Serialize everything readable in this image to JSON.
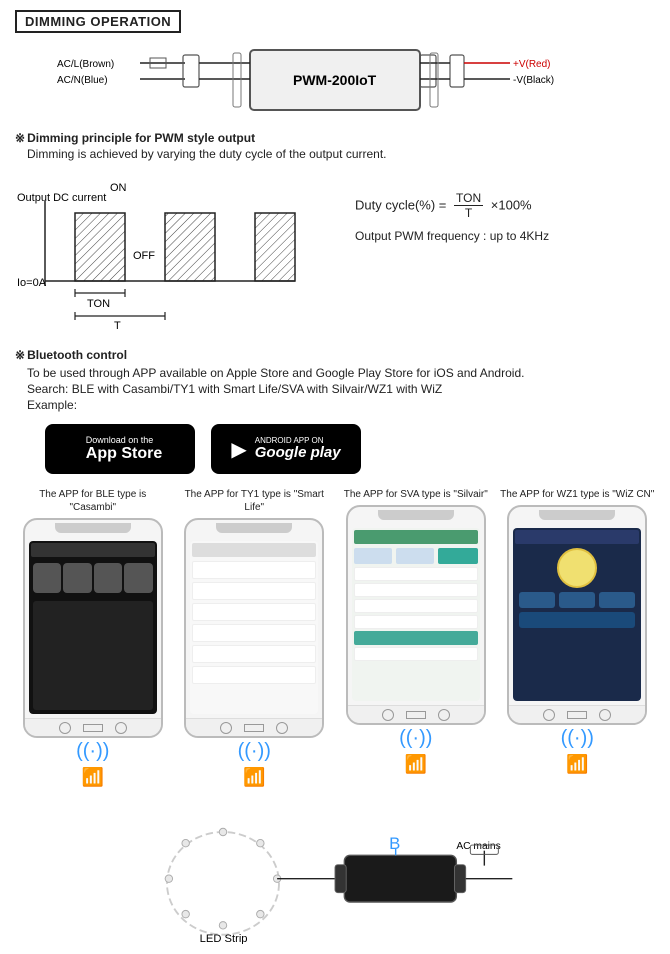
{
  "header": {
    "title": "DIMMING OPERATION"
  },
  "wiring": {
    "device_label": "PWM-200IoT",
    "input_ac_l": "AC/L(Brown)",
    "input_ac_n": "AC/N(Blue)",
    "output_pos": "+V(Red)",
    "output_neg": "-V(Black)"
  },
  "dimming_principle": {
    "title": "Dimming principle for PWM style output",
    "description": "Dimming is achieved by varying the duty cycle of the output current.",
    "y_label": "Output DC current",
    "on_label": "ON",
    "off_label": "OFF",
    "io_label": "Io=0A",
    "ton_label": "TON",
    "t_label": "T",
    "formula_prefix": "Duty cycle(%) =",
    "formula_num": "TON",
    "formula_den": "T",
    "formula_suffix": "×100%",
    "freq_text": "Output PWM frequency : up to 4KHz"
  },
  "bluetooth": {
    "title": "Bluetooth control",
    "description": "To be used through APP available on Apple Store and Google Play Store for iOS and Android.",
    "search_text": "Search: BLE with Casambi/TY1 with Smart Life/SVA with Silvair/WZ1 with WiZ",
    "example_label": "Example:",
    "app_store": {
      "line1": "Download on the",
      "line2": "App Store",
      "apple_symbol": ""
    },
    "google_play": {
      "line1": "ANDROID APP ON",
      "line2": "Google play"
    }
  },
  "phones": [
    {
      "caption": "The APP for BLE type is \"Casambi\"",
      "app_type": "casambi"
    },
    {
      "caption": "The APP for TY1 type is \"Smart Life\"",
      "app_type": "smartlife"
    },
    {
      "caption": "The APP for SVA type is \"Silvair\"",
      "app_type": "silvair"
    },
    {
      "caption": "The APP for WZ1 type is \"WiZ CN\"",
      "app_type": "wiz"
    }
  ],
  "bottom_diagram": {
    "bt_label": "Bluetooth icon",
    "ac_label": "AC mains",
    "led_label": "LED Strip",
    "device_label": "PWM-200IoT device"
  }
}
